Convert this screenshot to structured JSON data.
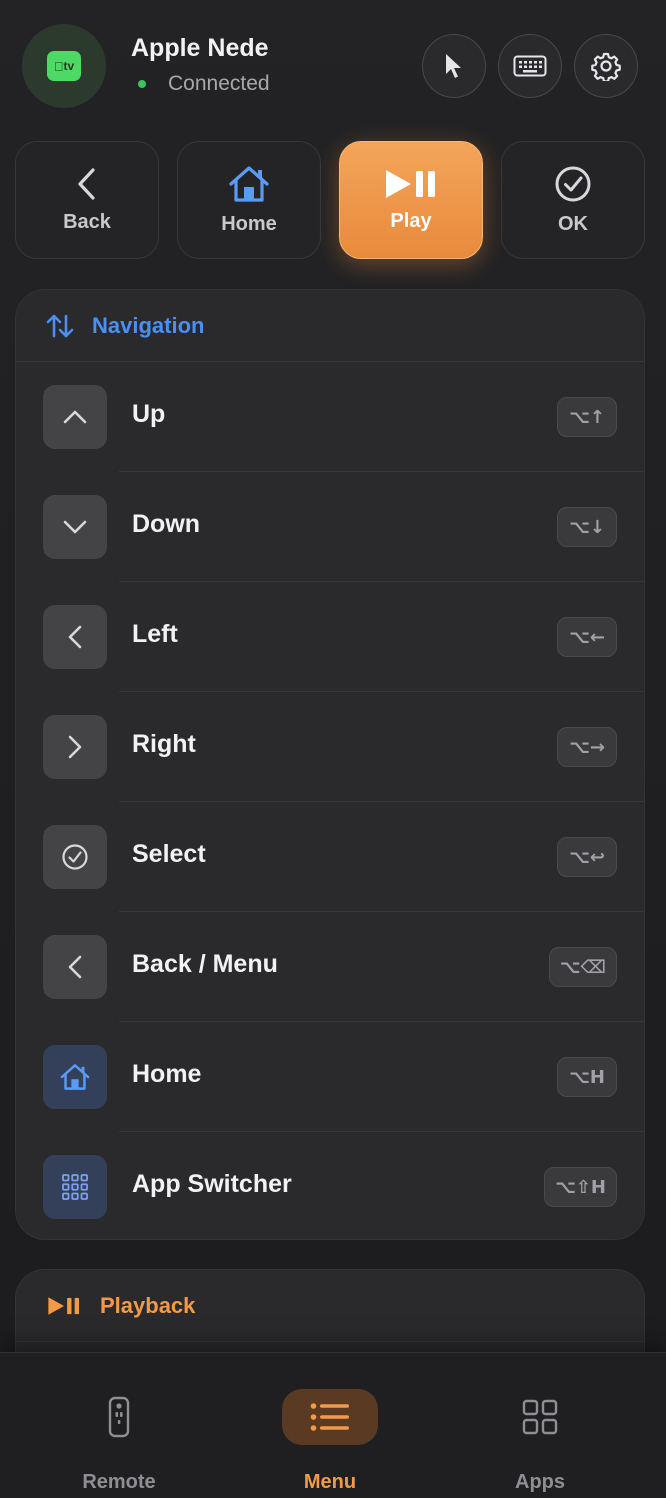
{
  "header": {
    "device_name": "Apple Nede",
    "status": "Connected",
    "device_logo_text": "tv",
    "colors": {
      "status_green": "#34c759",
      "logo_green": "#4cd964"
    },
    "actions": [
      {
        "name": "pointer-button",
        "icon": "cursor-arrow-icon"
      },
      {
        "name": "keyboard-button",
        "icon": "keyboard-icon"
      },
      {
        "name": "settings-button",
        "icon": "gear-icon"
      }
    ]
  },
  "quick_buttons": [
    {
      "label": "Back",
      "icon": "chevron-left-icon",
      "active": false
    },
    {
      "label": "Home",
      "icon": "home-icon",
      "active": false
    },
    {
      "label": "Play",
      "icon": "play-pause-icon",
      "active": true
    },
    {
      "label": "OK",
      "icon": "checkmark-circle-icon",
      "active": false
    }
  ],
  "navigation": {
    "title": "Navigation",
    "accent": "#4a8ff5",
    "rows": [
      {
        "label": "Up",
        "icon": "chevron-up-icon",
        "shortcut": "⌥↑"
      },
      {
        "label": "Down",
        "icon": "chevron-down-icon",
        "shortcut": "⌥↓"
      },
      {
        "label": "Left",
        "icon": "chevron-left-icon",
        "shortcut": "⌥←"
      },
      {
        "label": "Right",
        "icon": "chevron-right-icon",
        "shortcut": "⌥→"
      },
      {
        "label": "Select",
        "icon": "checkmark-circle-icon",
        "shortcut": "⌥↩"
      },
      {
        "label": "Back / Menu",
        "icon": "chevron-left-icon",
        "shortcut": "⌥⌫"
      },
      {
        "label": "Home",
        "icon": "home-icon",
        "shortcut": "⌥H"
      },
      {
        "label": "App Switcher",
        "icon": "grid-icon",
        "shortcut": "⌥⇧H"
      }
    ]
  },
  "playback": {
    "title": "Playback",
    "accent": "#f39a46"
  },
  "tabbar": {
    "active_color": "#f39a46",
    "tabs": [
      {
        "label": "Remote",
        "icon": "remote-icon",
        "active": false
      },
      {
        "label": "Menu",
        "icon": "list-icon",
        "active": true
      },
      {
        "label": "Apps",
        "icon": "apps-grid-icon",
        "active": false
      }
    ]
  }
}
